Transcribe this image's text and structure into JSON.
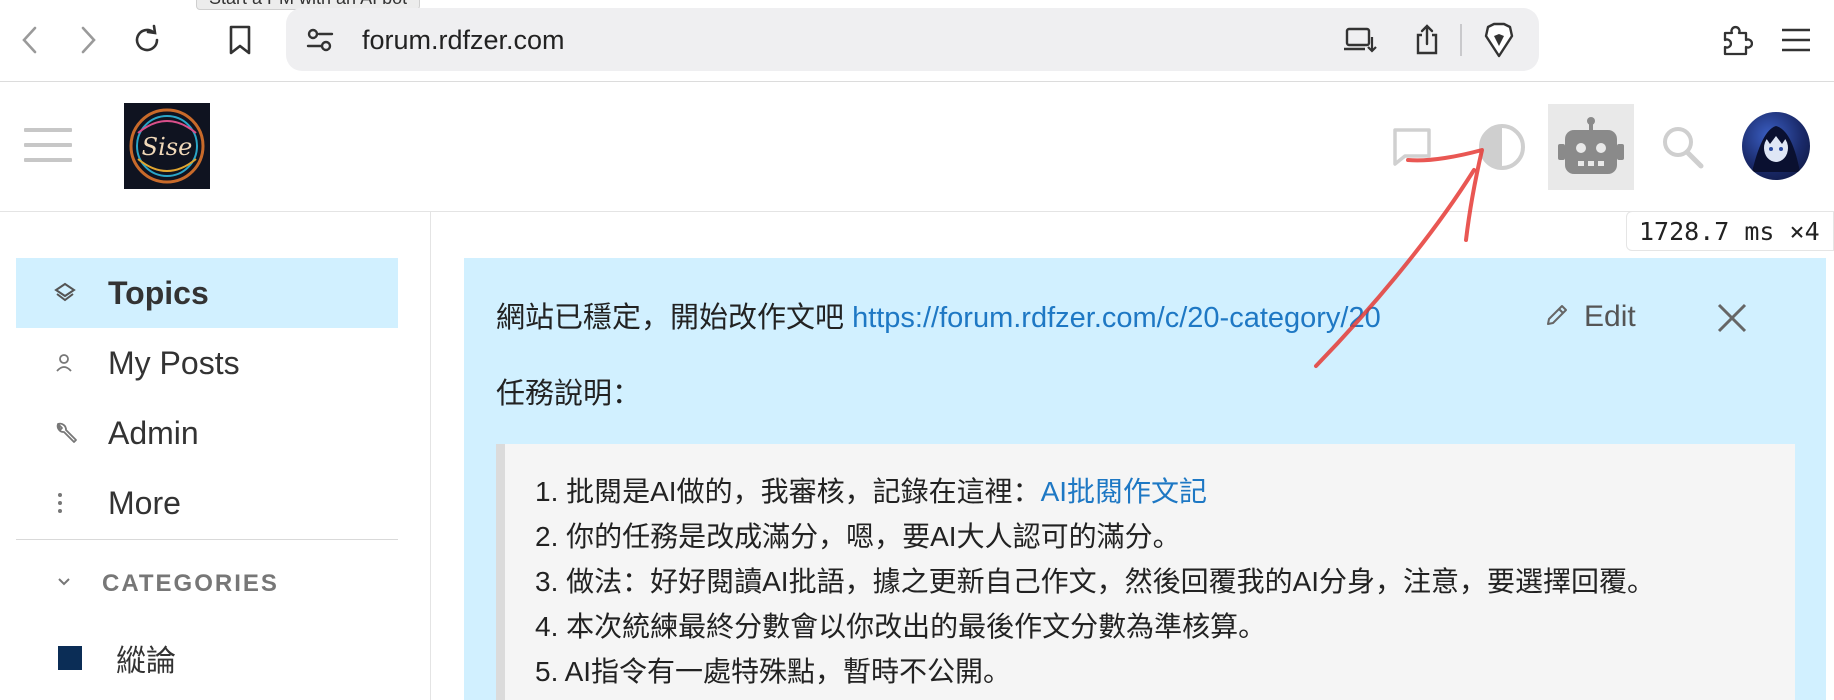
{
  "browser": {
    "tooltip": "Start a PM with an AI bot",
    "url": "forum.rdfzer.com",
    "icons": [
      "back-icon",
      "forward-icon",
      "reload-icon",
      "bookmark-icon",
      "site-settings-icon",
      "install-app-icon",
      "share-icon",
      "brave-shield-icon",
      "extensions-icon",
      "menu-icon"
    ]
  },
  "forum_header": {
    "logo_text": "Sise",
    "icons": [
      "hamburger-icon",
      "chat-icon",
      "theme-toggle-icon",
      "ai-bot-icon",
      "search-icon",
      "avatar"
    ]
  },
  "timing": {
    "text": "1728.7 ms ×4"
  },
  "sidebar": {
    "items": [
      {
        "label": "Topics",
        "icon": "layers-icon",
        "active": true
      },
      {
        "label": "My Posts",
        "icon": "user-icon",
        "active": false
      },
      {
        "label": "Admin",
        "icon": "wrench-icon",
        "active": false
      },
      {
        "label": "More",
        "icon": "ellipsis-vertical-icon",
        "active": false
      }
    ],
    "categories_header": "CATEGORIES",
    "categories": [
      {
        "label": "縱論",
        "color": "#0b2d56"
      }
    ]
  },
  "banner": {
    "line1_text": "網站已穩定，開始改作文吧 ",
    "line1_link": "https://forum.rdfzer.com/c/20-category/20",
    "line2": "任務說明：",
    "edit_label": "Edit",
    "list": [
      {
        "text": "1. 批閱是AI做的，我審核，記錄在這裡：",
        "link": "AI批閱作文記"
      },
      {
        "text": "2. 你的任務是改成滿分，嗯，要AI大人認可的滿分。",
        "link": ""
      },
      {
        "text": "3. 做法：好好閱讀AI批語，據之更新自己作文，然後回覆我的AI分身，注意，要選擇回覆。",
        "link": ""
      },
      {
        "text": "4. 本次統練最終分數會以你改出的最後作文分數為準核算。",
        "link": ""
      },
      {
        "text": "5. AI指令有一處特殊點，暫時不公開。",
        "link": ""
      }
    ]
  },
  "colors": {
    "banner_bg": "#d1f0ff",
    "active_nav_bg": "#d1f0ff",
    "link": "#1e78c4",
    "annotation_arrow": "#e53935"
  }
}
